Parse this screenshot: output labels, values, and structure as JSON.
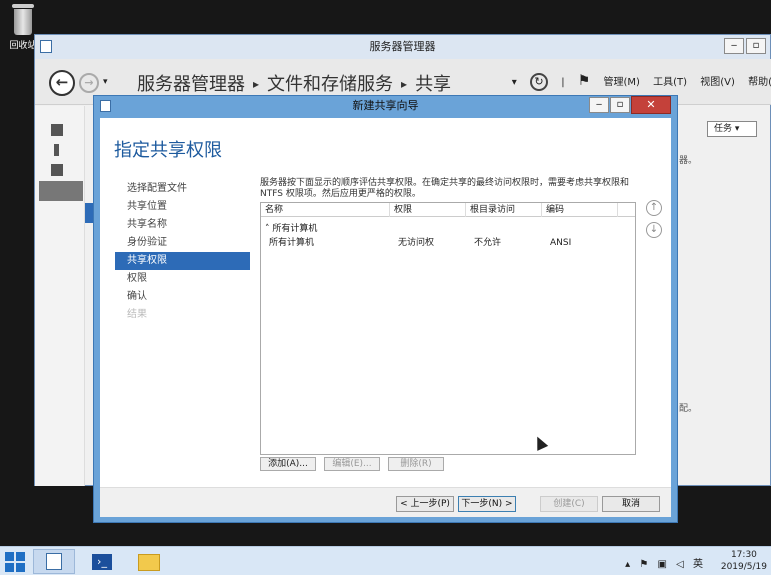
{
  "desktop": {
    "recycle_bin_label": "回收站"
  },
  "server_manager": {
    "title": "服务器管理器",
    "breadcrumb": [
      "服务器管理器",
      "文件和存储服务",
      "共享"
    ],
    "menu": {
      "manage": "管理(M)",
      "tools": "工具(T)",
      "view": "视图(V)",
      "help": "帮助("
    },
    "tasks_label": "任务",
    "right_snippet_1": "器。",
    "right_snippet_2": "配。"
  },
  "wizard": {
    "title": "新建共享向导",
    "heading": "指定共享权限",
    "steps": [
      {
        "label": "选择配置文件",
        "state": "normal"
      },
      {
        "label": "共享位置",
        "state": "normal"
      },
      {
        "label": "共享名称",
        "state": "normal"
      },
      {
        "label": "身份验证",
        "state": "normal"
      },
      {
        "label": "共享权限",
        "state": "active"
      },
      {
        "label": "权限",
        "state": "normal"
      },
      {
        "label": "确认",
        "state": "normal"
      },
      {
        "label": "结果",
        "state": "disabled"
      }
    ],
    "description_line1": "服务器按下面显示的顺序评估共享权限。在确定共享的最终访问权限时，需要考虑共享权限和",
    "description_line2": "NTFS 权限项。然后应用更严格的权限。",
    "columns": [
      "名称",
      "权限",
      "根目录访问",
      "编码"
    ],
    "group_label": "所有计算机",
    "rows": [
      {
        "name": "所有计算机",
        "permission": "无访问权",
        "root_access": "不允许",
        "encoding": "ANSI"
      }
    ],
    "buttons": {
      "add": "添加(A)...",
      "edit": "编辑(E)...",
      "remove": "删除(R)"
    },
    "footer": {
      "back": "< 上一步(P)",
      "next": "下一步(N) >",
      "create": "创建(C)",
      "cancel": "取消"
    }
  },
  "taskbar": {
    "time": "17:30",
    "date": "2019/5/19"
  }
}
